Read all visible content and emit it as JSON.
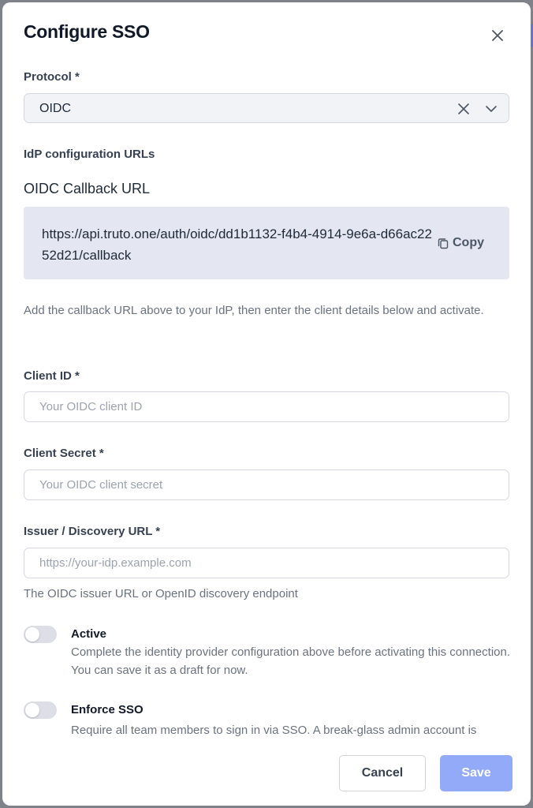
{
  "dialog": {
    "title": "Configure SSO"
  },
  "protocol": {
    "label": "Protocol *",
    "value": "OIDC"
  },
  "idp_urls": {
    "section_label": "IdP configuration URLs",
    "callback_title": "OIDC Callback URL",
    "callback_url": "https://api.truto.one/auth/oidc/dd1b1132-f4b4-4914-9e6a-d66ac2252d21/callback",
    "copy_label": "Copy"
  },
  "instructions": "Add the callback URL above to your IdP, then enter the client details below and activate.",
  "client_id": {
    "label": "Client ID *",
    "placeholder": "Your OIDC client ID"
  },
  "client_secret": {
    "label": "Client Secret *",
    "placeholder": "Your OIDC client secret"
  },
  "issuer": {
    "label": "Issuer / Discovery URL *",
    "placeholder": "https://your-idp.example.com",
    "help": "The OIDC issuer URL or OpenID discovery endpoint"
  },
  "active": {
    "title": "Active",
    "description": "Complete the identity provider configuration above before activating this connection. You can save it as a draft for now.",
    "enabled": false
  },
  "enforce_sso": {
    "title": "Enforce SSO",
    "description": "Require all team members to sign in via SSO. A break-glass admin account is",
    "enabled": false
  },
  "footer": {
    "cancel_label": "Cancel",
    "save_label": "Save"
  },
  "colors": {
    "primary_disabled": "#93aaf9",
    "url_box_bg": "#e4e7f1"
  },
  "icons": {
    "close": "close-icon",
    "clear": "clear-icon",
    "chevron": "chevron-down-icon",
    "copy": "copy-icon"
  }
}
